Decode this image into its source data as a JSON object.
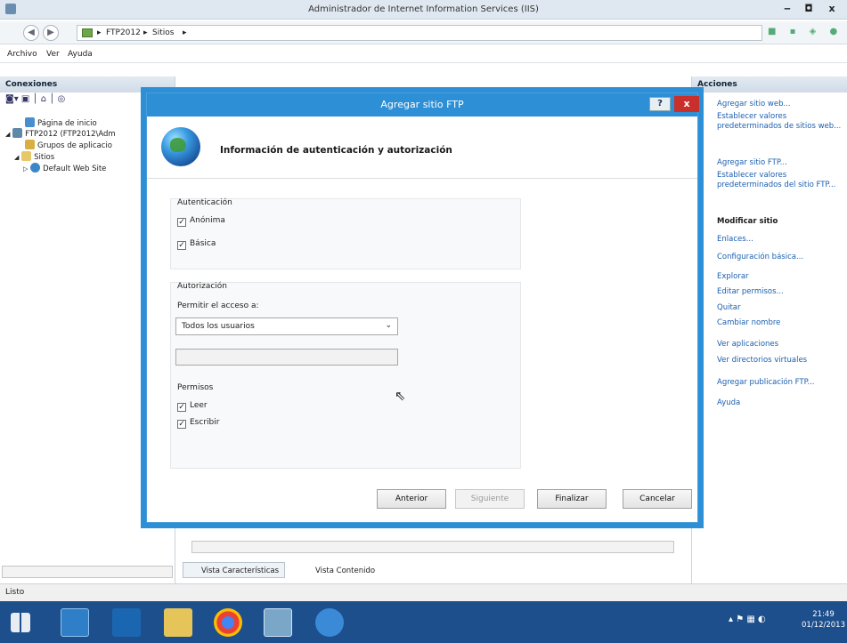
{
  "window": {
    "title": "Administrador de Internet Information Services (IIS)",
    "minimize": "‒",
    "maximize": "◘",
    "close": "x"
  },
  "address": {
    "path": [
      "FTP2012",
      "Sitios"
    ],
    "sep": "▸"
  },
  "menu": [
    "Archivo",
    "Ver",
    "Ayuda"
  ],
  "connections": {
    "header": "Conexiones",
    "tree": [
      "Página de inicio",
      "FTP2012 (FTP2012\\Adm",
      "Grupos de aplicacio",
      "Sitios",
      "Default Web Site"
    ]
  },
  "actions": {
    "header": "Acciones",
    "links1": [
      "Agregar sitio web...",
      "Establecer valores predeterminados de sitios web...",
      "Agregar sitio FTP...",
      "Establecer valores predeterminados del sitio FTP..."
    ],
    "section_title": "Modificar sitio",
    "links2": [
      "Enlaces...",
      "Configuración básica...",
      "Explorar",
      "Editar permisos...",
      "Quitar",
      "Cambiar nombre",
      "Ver aplicaciones",
      "Ver directorios virtuales",
      "Agregar publicación FTP...",
      "Ayuda"
    ]
  },
  "center": {
    "view_features": "Vista Características",
    "view_content": "Vista Contenido"
  },
  "status": {
    "text": "Listo"
  },
  "dialog": {
    "title": "Agregar sitio FTP",
    "help": "?",
    "close": "x",
    "heading": "Información de autenticación y autorización",
    "auth_group": "Autenticación",
    "anon_label": "Anónima",
    "anon_checked": true,
    "basic_label": "Básica",
    "basic_checked": true,
    "authz_group": "Autorización",
    "allow_label": "Permitir el acceso a:",
    "allow_value": "Todos los usuarios",
    "allow_text": "",
    "perms_label": "Permisos",
    "read_label": "Leer",
    "read_checked": true,
    "write_label": "Escribir",
    "write_checked": true,
    "btn_prev": "Anterior",
    "btn_next": "Siguiente",
    "btn_finish": "Finalizar",
    "btn_cancel": "Cancelar"
  },
  "taskbar": {
    "clock_time": "21:49",
    "clock_date": "01/12/2013"
  }
}
